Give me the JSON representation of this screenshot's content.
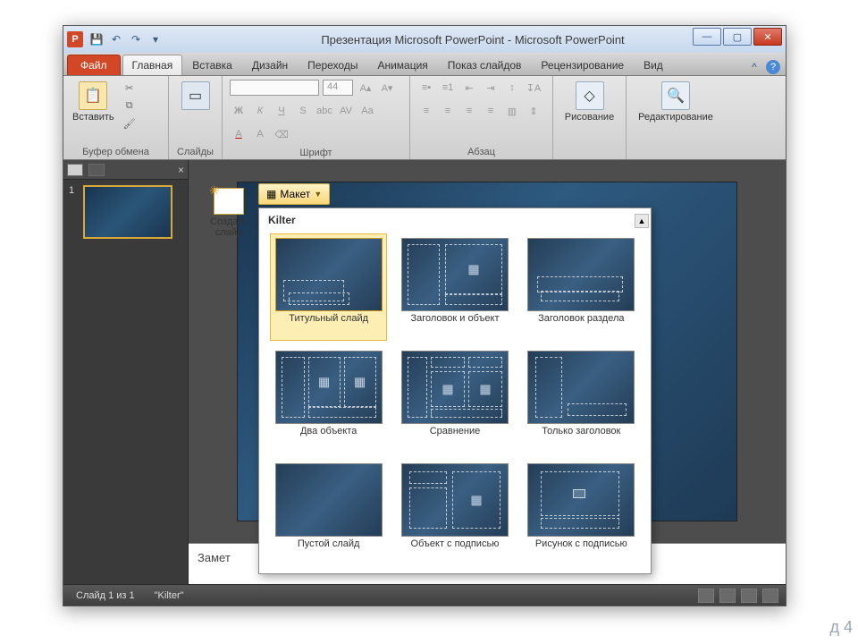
{
  "window": {
    "title": "Презентация Microsoft PowerPoint - Microsoft PowerPoint",
    "app_letter": "P"
  },
  "tabs": {
    "file": "Файл",
    "items": [
      "Главная",
      "Вставка",
      "Дизайн",
      "Переходы",
      "Анимация",
      "Показ слайдов",
      "Рецензирование",
      "Вид"
    ]
  },
  "ribbon_groups": {
    "clipboard": {
      "label": "Буфер обмена",
      "paste": "Вставить"
    },
    "slides": {
      "label": "Слайды",
      "new_slide": "Создать слайд",
      "layout_btn": "Макет"
    },
    "font": {
      "label": "Шрифт",
      "size_placeholder": "44"
    },
    "paragraph": {
      "label": "Абзац"
    },
    "drawing": {
      "label": "Рисование"
    },
    "editing": {
      "label": "Редактирование"
    }
  },
  "layout_popup": {
    "theme": "Kilter",
    "items": [
      "Титульный слайд",
      "Заголовок и объект",
      "Заголовок раздела",
      "Два объекта",
      "Сравнение",
      "Только заголовок",
      "Пустой слайд",
      "Объект с подписью",
      "Рисунок с подписью"
    ]
  },
  "thumbs": {
    "slide_number": "1"
  },
  "notes": {
    "placeholder": "Замет"
  },
  "status": {
    "slide": "Слайд 1 из 1",
    "theme": "\"Kilter\""
  },
  "corner": "д 4"
}
